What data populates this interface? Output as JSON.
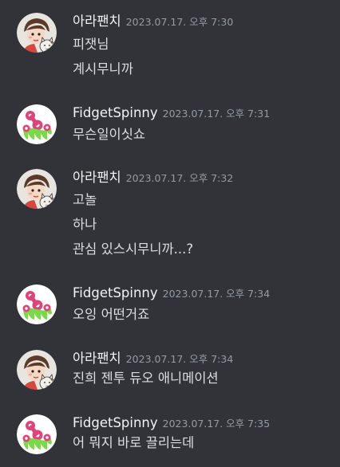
{
  "users": {
    "user_a": "아라팬치",
    "user_b": "FidgetSpinny"
  },
  "colors": {
    "background": "#313338",
    "username": "#f2f3f5",
    "timestamp": "#949ba4",
    "text": "#dbdee1"
  },
  "avatars": {
    "user_a": "cartoon-girl-with-cat-avatar",
    "user_b": "fidget-spinner-logo-avatar"
  },
  "messages": [
    {
      "author": "아라팬치",
      "time": "2023.07.17. 오후 7:30",
      "lines": [
        "피잿님",
        "계시무니까"
      ]
    },
    {
      "author": "FidgetSpinny",
      "time": "2023.07.17. 오후 7:31",
      "lines": [
        "무슨일이싯쇼"
      ]
    },
    {
      "author": "아라팬치",
      "time": "2023.07.17. 오후 7:32",
      "lines": [
        "고놀",
        "하나",
        "관심 있스시무니까...?"
      ]
    },
    {
      "author": "FidgetSpinny",
      "time": "2023.07.17. 오후 7:34",
      "lines": [
        "오잉 어떤거죠"
      ]
    },
    {
      "author": "아라팬치",
      "time": "2023.07.17. 오후 7:34",
      "lines": [
        "진희 젠투 듀오 애니메이션"
      ]
    },
    {
      "author": "FidgetSpinny",
      "time": "2023.07.17. 오후 7:35",
      "lines": [
        "어 뭐지 바로 끌리는데"
      ]
    }
  ]
}
